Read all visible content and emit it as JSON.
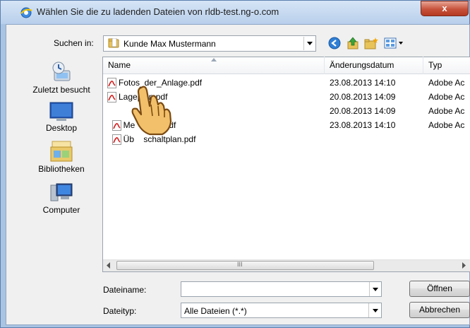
{
  "window": {
    "title": "Wählen Sie die zu ladenden Dateien von rldb-test.ng-o.com",
    "close_label": "x"
  },
  "lookin": {
    "label": "Suchen in:",
    "value": "Kunde Max Mustermann"
  },
  "places": [
    {
      "label": "Zuletzt besucht",
      "icon": "recent-places-icon"
    },
    {
      "label": "Desktop",
      "icon": "desktop-icon"
    },
    {
      "label": "Bibliotheken",
      "icon": "libraries-icon"
    },
    {
      "label": "Computer",
      "icon": "computer-icon"
    }
  ],
  "columns": [
    "Name",
    "Änderungsdatum",
    "Typ"
  ],
  "files": [
    {
      "name": "Fotos_der_Anlage.pdf",
      "date": "23.08.2013 14:10",
      "type": "Adobe Ac"
    },
    {
      "name": "Lageplan.pdf",
      "date": "20.08.2013 14:09",
      "type": "Adobe Ac"
    },
    {
      "name": "Me    BNA.pdf",
      "date": "20.08.2013 14:09",
      "type": "Adobe Ac"
    },
    {
      "name": "Üb    schaltplan.pdf",
      "date": "23.08.2013 14:10",
      "type": "Adobe Ac"
    }
  ],
  "scrollbar": {
    "grip": "III"
  },
  "bottom": {
    "filename_label": "Dateiname:",
    "filename_value": "",
    "filetype_label": "Dateityp:",
    "filetype_value": "Alle Dateien (*.*)",
    "open_label": "Öffnen",
    "cancel_label": "Abbrechen"
  },
  "colors": {
    "titlebar": "#b8cfeb",
    "close": "#c7523b",
    "pdf_red": "#d42020"
  },
  "cursor": {
    "icon": "hand-pointer-icon"
  }
}
